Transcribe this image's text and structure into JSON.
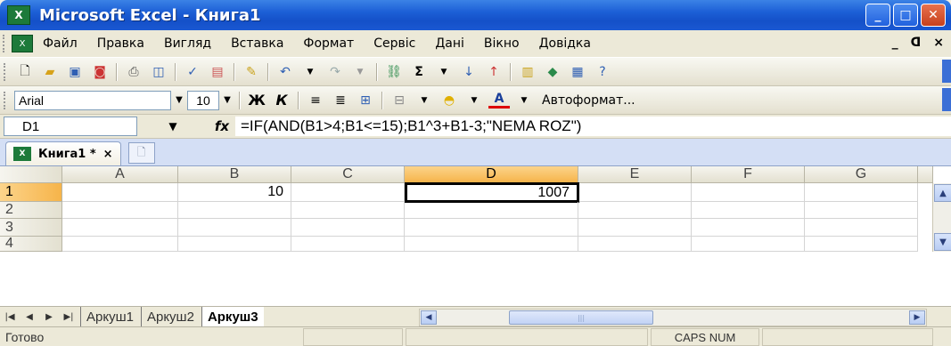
{
  "window": {
    "title": "Microsoft Excel - Книга1"
  },
  "menu": {
    "items": [
      "Файл",
      "Правка",
      "Вигляд",
      "Вставка",
      "Формат",
      "Сервіс",
      "Дані",
      "Вікно",
      "Довідка"
    ],
    "right_controls": [
      "_",
      "ᗡ",
      "×"
    ]
  },
  "format_toolbar": {
    "font": "Arial",
    "size": "10",
    "bold_label": "Ж",
    "italic_label": "К",
    "autoformat_label": "Автоформат..."
  },
  "formula_bar": {
    "name_box": "D1",
    "fx": "fx",
    "formula": "=IF(AND(B1>4;B1<=15);B1^3+B1-3;\"NEMA ROZ\")"
  },
  "workbook_tab": {
    "label": "Книга1 *",
    "close": "×"
  },
  "grid": {
    "columns": [
      "A",
      "B",
      "C",
      "D",
      "E",
      "F",
      "G"
    ],
    "rows": [
      "1",
      "2",
      "3",
      "4"
    ],
    "cells": {
      "B1": "10",
      "D1": "1007"
    },
    "selected_cell": "D1"
  },
  "sheet_tabs": [
    "Аркуш1",
    "Аркуш2",
    "Аркуш3"
  ],
  "active_sheet": "Аркуш3",
  "status": {
    "ready": "Готово",
    "indicators": "CAPS NUM"
  }
}
